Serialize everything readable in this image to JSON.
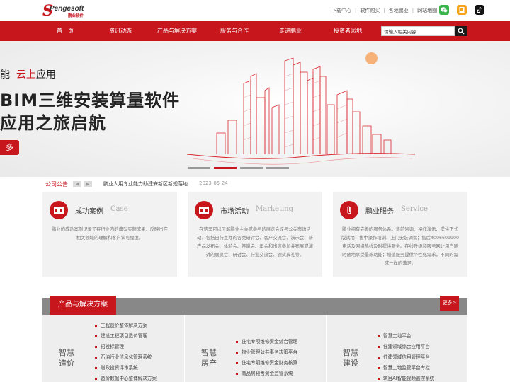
{
  "brand": {
    "logo_text": "Pengesoft",
    "logo_cn": "鹏业软件"
  },
  "toplinks": [
    "下载中心",
    "软件购买",
    "各地鹏业",
    "网站地图"
  ],
  "social": [
    {
      "icon": "wechat-icon",
      "color": "#39b54a"
    },
    {
      "icon": "weibo-icon",
      "color": "#f5a31a"
    },
    {
      "icon": "tiktok-icon",
      "color": "#111111"
    }
  ],
  "nav": {
    "items": [
      "首　页",
      "资讯动态",
      "产品与解决方案",
      "服务与合作",
      "走进鹏业",
      "投资者园地"
    ],
    "search_placeholder": "请输入相关内容"
  },
  "banner": {
    "line1_prefix": "能",
    "line1_red": "云上",
    "line1_suffix": "应用",
    "line2": "BIM三维安装算量软件",
    "line3": "应用之旅启航",
    "button": "多",
    "slide_count": 4,
    "active_slide": 2
  },
  "notice": {
    "label": "公司公告",
    "text": "鹏业人用专业能力助建安新区新规落地",
    "date": "2023-05-24"
  },
  "cards": [
    {
      "title": "成功案例",
      "en": "Case",
      "icon": "case-icon",
      "desc": "鹏业的成功案例记录了在行业内的典型实施成果，反映出在相关领域的理解和客户认可程度。"
    },
    {
      "title": "市场活动",
      "en": "Marketing",
      "icon": "marketing-icon",
      "desc": "在这里可以了解鹏业主办或参与的展览会议与公关市场活动，包括自行主办的各类研讨会、客户交流会、演示会、新产品发布会、体验会、答谢会、年会和出席参加并布展或演讲的展览会、研讨会、行业交流会、颁奖典礼等。"
    },
    {
      "title": "鹏业服务",
      "en": "Service",
      "icon": "paperclip-icon",
      "desc": "鹏业拥有完善的服务体系。售前咨询、操作演示、提供正式版试用；售中操作培训、上门安装调试；售后4006609900电话及网络热线及时提供服务。在线升级和服务网让用户随时随地享受最新功能；增值服务提供个性化需求，不同的需求一样的满足。"
    }
  ],
  "products": {
    "header": "产品与解决方案",
    "more": "更多>",
    "sections": [
      {
        "title": "智慧造价",
        "items": [
          "工程造价整体解决方案",
          "建设工程项目造价管理",
          "招投标管理",
          "石油行业信息化管理系统",
          "财政投资评审系统",
          "造价数据中心整体解决方案"
        ]
      },
      {
        "title": "智慧房产",
        "items": [
          "住宅专项维修资金综合管理",
          "物业管理公共事务决策平台",
          "住宅专项维修资金财务核算",
          "商品房预售资金监管系统"
        ]
      },
      {
        "title": "智慧建设",
        "items": [
          "智慧工地平台",
          "住建领域综合应用平台",
          "住建领域信用管理平台",
          "智慧工地监管平台专栏",
          "筑目AI智能视频监控系统"
        ]
      }
    ]
  },
  "colors": {
    "brand_red": "#c8161d",
    "panel_bg": "#f2f2f2"
  }
}
